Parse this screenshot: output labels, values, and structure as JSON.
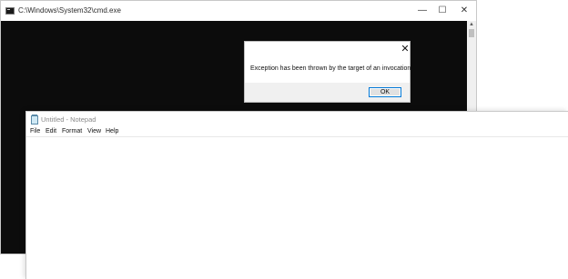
{
  "cmd": {
    "title": "C:\\Windows\\System32\\cmd.exe",
    "icon": "console-icon",
    "controls": {
      "minimize": "—",
      "maximize": "☐",
      "close": "✕"
    },
    "scroll_arrow": "▲"
  },
  "dialog": {
    "message": "Exception has been thrown by the target of an invocation.",
    "ok_label": "OK",
    "close_glyph": "✕"
  },
  "notepad": {
    "title": "Untitled - Notepad",
    "icon": "notepad-icon",
    "menu": [
      "File",
      "Edit",
      "Format",
      "View",
      "Help"
    ],
    "content": ""
  }
}
